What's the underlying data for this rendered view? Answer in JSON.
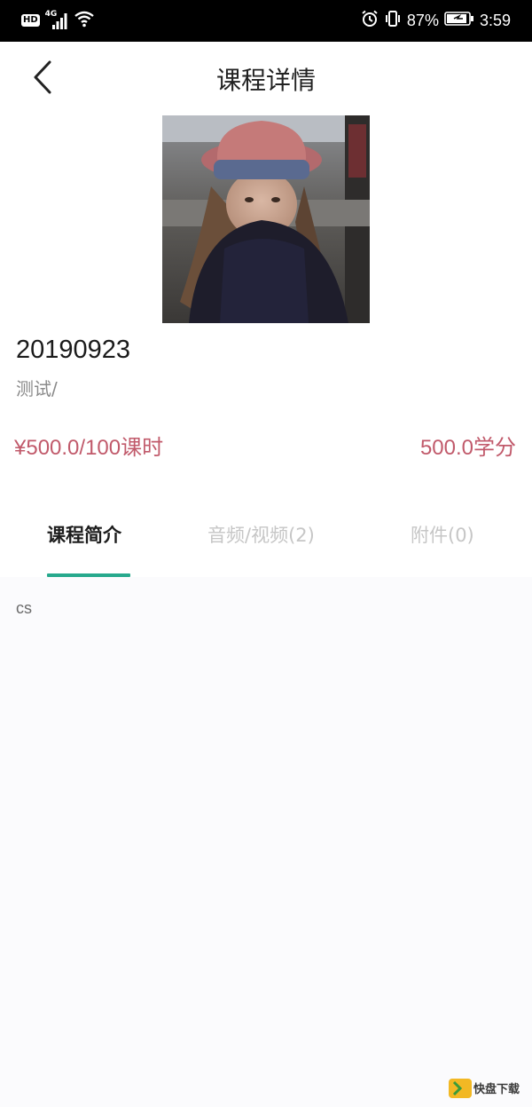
{
  "status_bar": {
    "hd": "HD",
    "network": "4G",
    "battery_percent": "87%",
    "time": "3:59"
  },
  "header": {
    "title": "课程详情"
  },
  "course": {
    "code": "20190923",
    "tag": "测试/",
    "price": "¥500.0/100课时",
    "credit": "500.0学分"
  },
  "tabs": [
    {
      "label": "课程简介",
      "active": true
    },
    {
      "label": "音频/视频(2)",
      "active": false
    },
    {
      "label": "附件(0)",
      "active": false
    }
  ],
  "content": {
    "intro": "cs"
  },
  "watermark": {
    "brand": "快盘下载"
  },
  "colors": {
    "accent": "#27a98d",
    "price": "#c15a6b"
  }
}
